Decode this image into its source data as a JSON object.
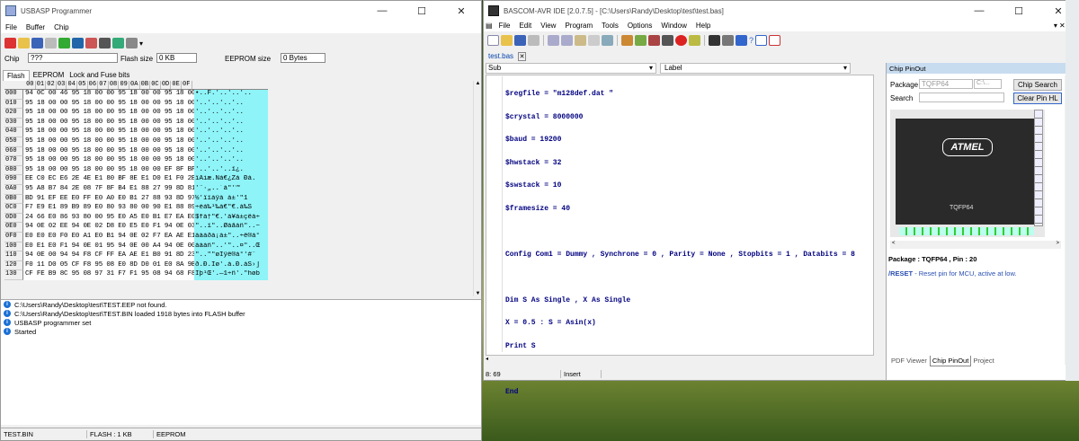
{
  "usbasp": {
    "title": "USBASP Programmer",
    "menu": [
      "File",
      "Buffer",
      "Chip"
    ],
    "chip_label": "Chip",
    "chip_value": "???",
    "flash_size_label": "Flash size",
    "flash_size_value": "0 KB",
    "eeprom_size_label": "EEPROM size",
    "eeprom_size_value": "0 Bytes",
    "tabs": [
      "Flash",
      "EEPROM",
      "Lock and Fuse bits"
    ],
    "hex_header": [
      "00",
      "01",
      "02",
      "03",
      "04",
      "05",
      "06",
      "07",
      "08",
      "09",
      "0A",
      "0B",
      "0C",
      "0D",
      "0E",
      "0F"
    ],
    "rows": [
      {
        "addr": "000",
        "hex": "94 0C 00 46 95 18 00 00 95 18 00 00 95 18 00 00",
        "ascii": "•..F.'..'..'.."
      },
      {
        "addr": "010",
        "hex": "95 18 00 00 95 18 00 00 95 18 00 00 95 18 00 00",
        "ascii": "'..'..'..'.."
      },
      {
        "addr": "020",
        "hex": "95 18 00 00 95 18 00 00 95 18 00 00 95 18 00 00",
        "ascii": "'..'..'..'.."
      },
      {
        "addr": "030",
        "hex": "95 18 00 00 95 18 00 00 95 18 00 00 95 18 00 00",
        "ascii": "'..'..'..'.."
      },
      {
        "addr": "040",
        "hex": "95 18 00 00 95 18 00 00 95 18 00 00 95 18 00 00",
        "ascii": "'..'..'..'.."
      },
      {
        "addr": "050",
        "hex": "95 18 00 00 95 18 00 00 95 18 00 00 95 18 00 00",
        "ascii": "'..'..'..'.."
      },
      {
        "addr": "060",
        "hex": "95 18 00 00 95 18 00 00 95 18 00 00 95 18 00 00",
        "ascii": "'..'..'..'.."
      },
      {
        "addr": "070",
        "hex": "95 18 00 00 95 18 00 00 95 18 00 00 95 18 00 00",
        "ascii": "'..'..'..'.."
      },
      {
        "addr": "080",
        "hex": "95 18 00 00 95 18 00 00 95 18 00 00 EF 8F BF 8D",
        "ascii": "'..'..'..ï¿."
      },
      {
        "addr": "090",
        "hex": "EE C0 EC E6 2E 4E E1 80 BF 8E E1 D0 E1 F0 2E 5F",
        "ascii": "îÀìæ.Ná€¿Žá Ðá."
      },
      {
        "addr": "0A0",
        "hex": "95 A8 B7 84 2E 08 7F 8F B4 E1 88 27 99 8D 81",
        "ascii": "'¨·„..´á\"'™"
      },
      {
        "addr": "0B0",
        "hex": "BD 91 EF EE E0 FF E0 A0 E0 B1 27 88 93 8D 97 31",
        "ascii": "½'ïîàÿà à±'\"1"
      },
      {
        "addr": "0C0",
        "hex": "F7 E9 E1 89 B9 89 E0 80 93 80 00 90 E1 88 89 8A",
        "ascii": "÷éá‰¹‰à€\"€.á‰Š"
      },
      {
        "addr": "0D0",
        "hex": "24 66 E0 86 93 80 00 95 E0 A5 E0 B1 E7 EA E0 F7",
        "ascii": "$fà†\"€.'à¥à±çêà÷"
      },
      {
        "addr": "0E0",
        "hex": "94 0E 02 EE 94 0E 02 D8 E0 E5 E0 F1 94 0E 03 7E",
        "ascii": "\"..î\"..Øàåàñ\"..~"
      },
      {
        "addr": "0F0",
        "hex": "E0 E0 E0 F0 E0 A1 E0 B1 94 0E 02 F7 EA AE E1 B0",
        "ascii": "àààðà¡à±\"..÷ê®á°"
      },
      {
        "addr": "100",
        "hex": "E0 E1 E0 F1 94 0E 01 95 94 0E 00 A4 94 0E 00 8C",
        "ascii": "àáàñ\"..'\"..¤\"..Œ"
      },
      {
        "addr": "110",
        "hex": "94 0E 00 94 94 F8 CF FF EA AE E1 B0 91 8D 23 88",
        "ascii": "\"..\"\"øÏÿê®á°'#ˆ"
      },
      {
        "addr": "120",
        "hex": "F0 11 D0 05 CF F8 95 08 E0 8D D0 01 E0 8A 9B 5D",
        "ascii": "ð.Ð.Ïø'.à.Ð.àŠ›]"
      },
      {
        "addr": "130",
        "hex": "CF FE B9 8C 95 08 97 31 F7 F1 95 08 94 68 F8 62",
        "ascii": "Ïþ¹Œ'.—1÷ñ'.\"høb"
      }
    ],
    "log": [
      "C:\\Users\\Randy\\Desktop\\test\\TEST.EEP not found.",
      "C:\\Users\\Randy\\Desktop\\test\\TEST.BIN loaded 1918 bytes into FLASH buffer",
      "USBASP programmer set",
      "Started"
    ],
    "status": [
      "TEST.BIN",
      "FLASH : 1 KB",
      "EEPROM"
    ]
  },
  "ide": {
    "title": "BASCOM-AVR IDE [2.0.7.5] - [C:\\Users\\Randy\\Desktop\\test\\test.bas]",
    "menu": [
      "File",
      "Edit",
      "View",
      "Program",
      "Tools",
      "Options",
      "Window",
      "Help"
    ],
    "file_tab": "test.bas",
    "sub_label": "Sub",
    "label_label": "Label",
    "code_lines": [
      "$regfile = \"m128def.dat \"",
      "$crystal = 8000000",
      "$baud = 19200",
      "$hwstack = 32",
      "$swstack = 10",
      "$framesize = 40",
      "",
      "Config Com1 = Dummy , Synchrone = 0 , Parity = None , Stopbits = 1 , Databits = 8",
      "",
      "Dim S As Single , X As Single",
      "X = 0.5 : S = Asin(x)",
      "Print S",
      "",
      "End"
    ],
    "status_pos": "8: 69",
    "status_mode": "Insert",
    "pinout": {
      "title": "Chip PinOut",
      "package_label": "Package",
      "package_value": "TQFP64",
      "package_combo": "C:\\...",
      "search_label": "Search",
      "chip_search_button": "Chip Search",
      "clear_pin_button": "Clear Pin HL",
      "logo_text": "ATMEL",
      "chip_text": "TQFP64",
      "pin_info": "Package : TQFP64 , Pin : 20",
      "pin_desc_name": "/RESET",
      "pin_desc_text": "- Reset pin for MCU, active at low.",
      "tabs": [
        "PDF Viewer",
        "Chip PinOut",
        "Project"
      ]
    }
  }
}
